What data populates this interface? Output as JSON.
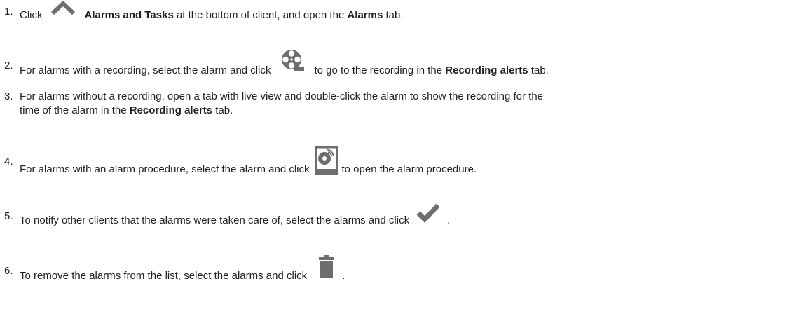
{
  "steps": [
    {
      "number": "1.",
      "t1": "Click",
      "icon": "chevron-up-icon",
      "b1": "Alarms and Tasks",
      "t2": " at the bottom of client, and open the ",
      "b2": "Alarms",
      "t3": " tab."
    },
    {
      "number": "2.",
      "t1": "For alarms with a recording, select the alarm and click",
      "icon": "film-reel-icon",
      "t2": "to go to the recording in the ",
      "b1": "Recording alerts",
      "t3": " tab."
    },
    {
      "number": "3.",
      "t1": "For alarms without a recording, open a tab with live view and double-click the alarm to show the recording for the",
      "t2": "time of the alarm in the ",
      "b1": "Recording alerts",
      "t3": " tab."
    },
    {
      "number": "4.",
      "t1": "For alarms with an alarm procedure, select the alarm and click",
      "icon": "alarm-procedure-icon",
      "t2": "to open the alarm procedure."
    },
    {
      "number": "5.",
      "t1": "To notify other clients that the alarms were taken care of, select the alarms and click",
      "icon": "checkmark-icon",
      "t2": "."
    },
    {
      "number": "6.",
      "t1": "To remove the alarms from the list, select the alarms and click",
      "icon": "trash-icon",
      "t2": "."
    }
  ],
  "icon_color": "#6e6e6e"
}
